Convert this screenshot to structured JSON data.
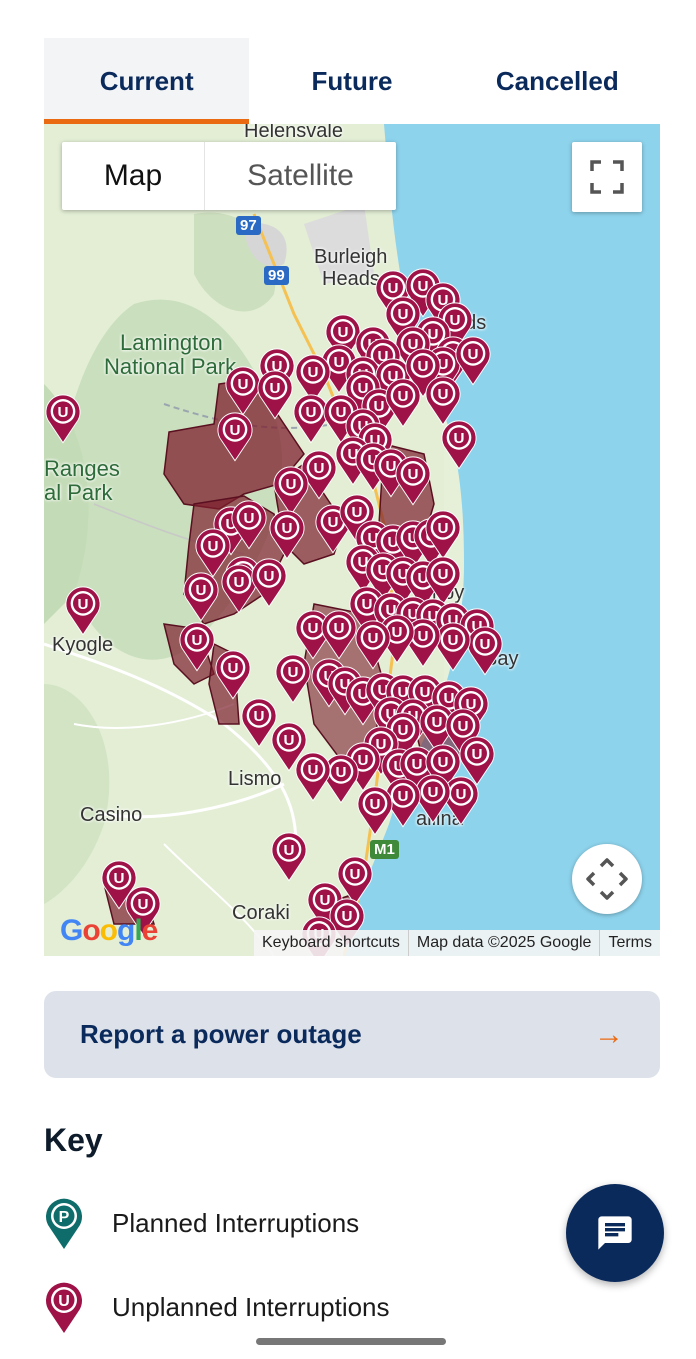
{
  "tabs": [
    {
      "label": "Current",
      "active": true
    },
    {
      "label": "Future",
      "active": false
    },
    {
      "label": "Cancelled",
      "active": false
    }
  ],
  "map": {
    "type_buttons": {
      "map": "Map",
      "satellite": "Satellite"
    },
    "places": {
      "helensvale": "Helensvale",
      "burleigh_1": "Burleigh",
      "burleigh_2": "Heads",
      "heads_partial": "ads",
      "lamington_1": "Lamington",
      "lamington_2": "National Park",
      "ranges_1": "Ranges",
      "ranges_2": "al Park",
      "kyogle": "Kyogle",
      "byron_partial": "nby",
      "bay": "Bay",
      "lismore": "Lismo",
      "casino": "Casino",
      "ballina": "allina",
      "coraki": "Coraki"
    },
    "road_shields": {
      "m1": "M1",
      "r97": "97",
      "r99": "99"
    },
    "pin_letter": "U",
    "google_logo": "Google",
    "attribution": {
      "shortcuts": "Keyboard shortcuts",
      "data": "Map data ©2025 Google",
      "terms": "Terms"
    }
  },
  "report": {
    "label": "Report a power outage",
    "arrow": "→"
  },
  "key": {
    "title": "Key",
    "planned": {
      "letter": "P",
      "label": "Planned Interruptions"
    },
    "unplanned": {
      "letter": "U",
      "label": "Unplanned Interruptions"
    }
  },
  "colors": {
    "brand_navy": "#0b2a5c",
    "accent_orange": "#ea6a12",
    "unplanned_pin": "#9e1248",
    "planned_pin": "#0e6d6a",
    "outage_area": "#7d1f2e",
    "ocean": "#8dd3ec",
    "land": "#e6f0d8"
  },
  "icons": {
    "fullscreen": "fullscreen-icon",
    "recenter": "recenter-icon",
    "report_arrow": "arrow-right-icon",
    "chat": "chat-icon"
  }
}
